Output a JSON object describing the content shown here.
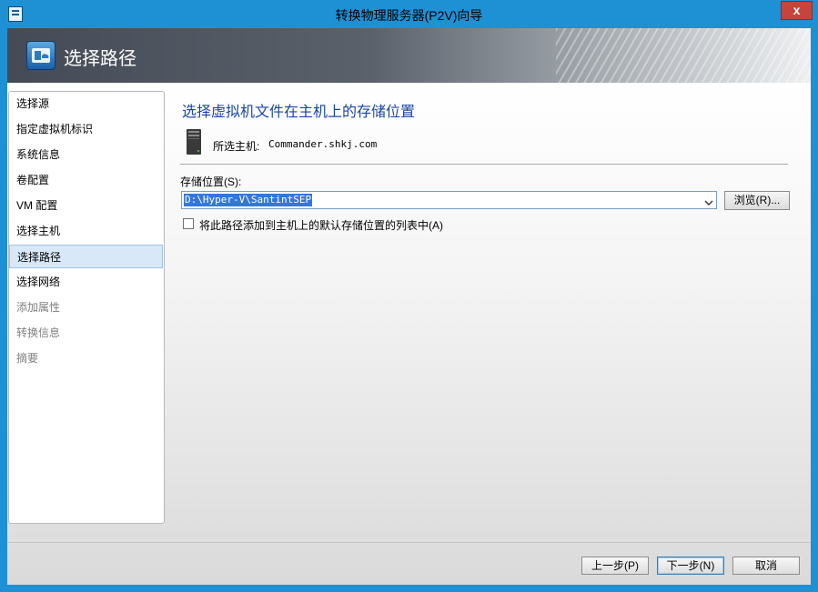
{
  "window": {
    "title": "转换物理服务器(P2V)向导",
    "close_label": "x"
  },
  "banner": {
    "title": "选择路径",
    "icon": "wizard-cloud-icon"
  },
  "sidebar": {
    "items": [
      {
        "label": "选择源",
        "state": "normal"
      },
      {
        "label": "指定虚拟机标识",
        "state": "normal"
      },
      {
        "label": "系统信息",
        "state": "normal"
      },
      {
        "label": "卷配置",
        "state": "normal"
      },
      {
        "label": "VM 配置",
        "state": "normal"
      },
      {
        "label": "选择主机",
        "state": "normal"
      },
      {
        "label": "选择路径",
        "state": "active"
      },
      {
        "label": "选择网络",
        "state": "normal"
      },
      {
        "label": "添加属性",
        "state": "disabled"
      },
      {
        "label": "转换信息",
        "state": "disabled"
      },
      {
        "label": "摘要",
        "state": "disabled"
      }
    ]
  },
  "main": {
    "section_title": "选择虚拟机文件在主机上的存储位置",
    "host_label": "所选主机:",
    "host_value": "Commander.shkj.com",
    "path_label": "存储位置(S):",
    "path_value": "D:\\Hyper-V\\SantintSEP",
    "browse_label": "浏览(R)...",
    "checkbox_label": "将此路径添加到主机上的默认存储位置的列表中(A)",
    "checkbox_checked": false
  },
  "footer": {
    "prev_label": "上一步(P)",
    "next_label": "下一步(N)",
    "cancel_label": "取消"
  },
  "colors": {
    "title_bar": "#1e90d4",
    "accent_text": "#1a46a8",
    "selection": "#3377dd",
    "active_item": "#d8e8f8"
  }
}
